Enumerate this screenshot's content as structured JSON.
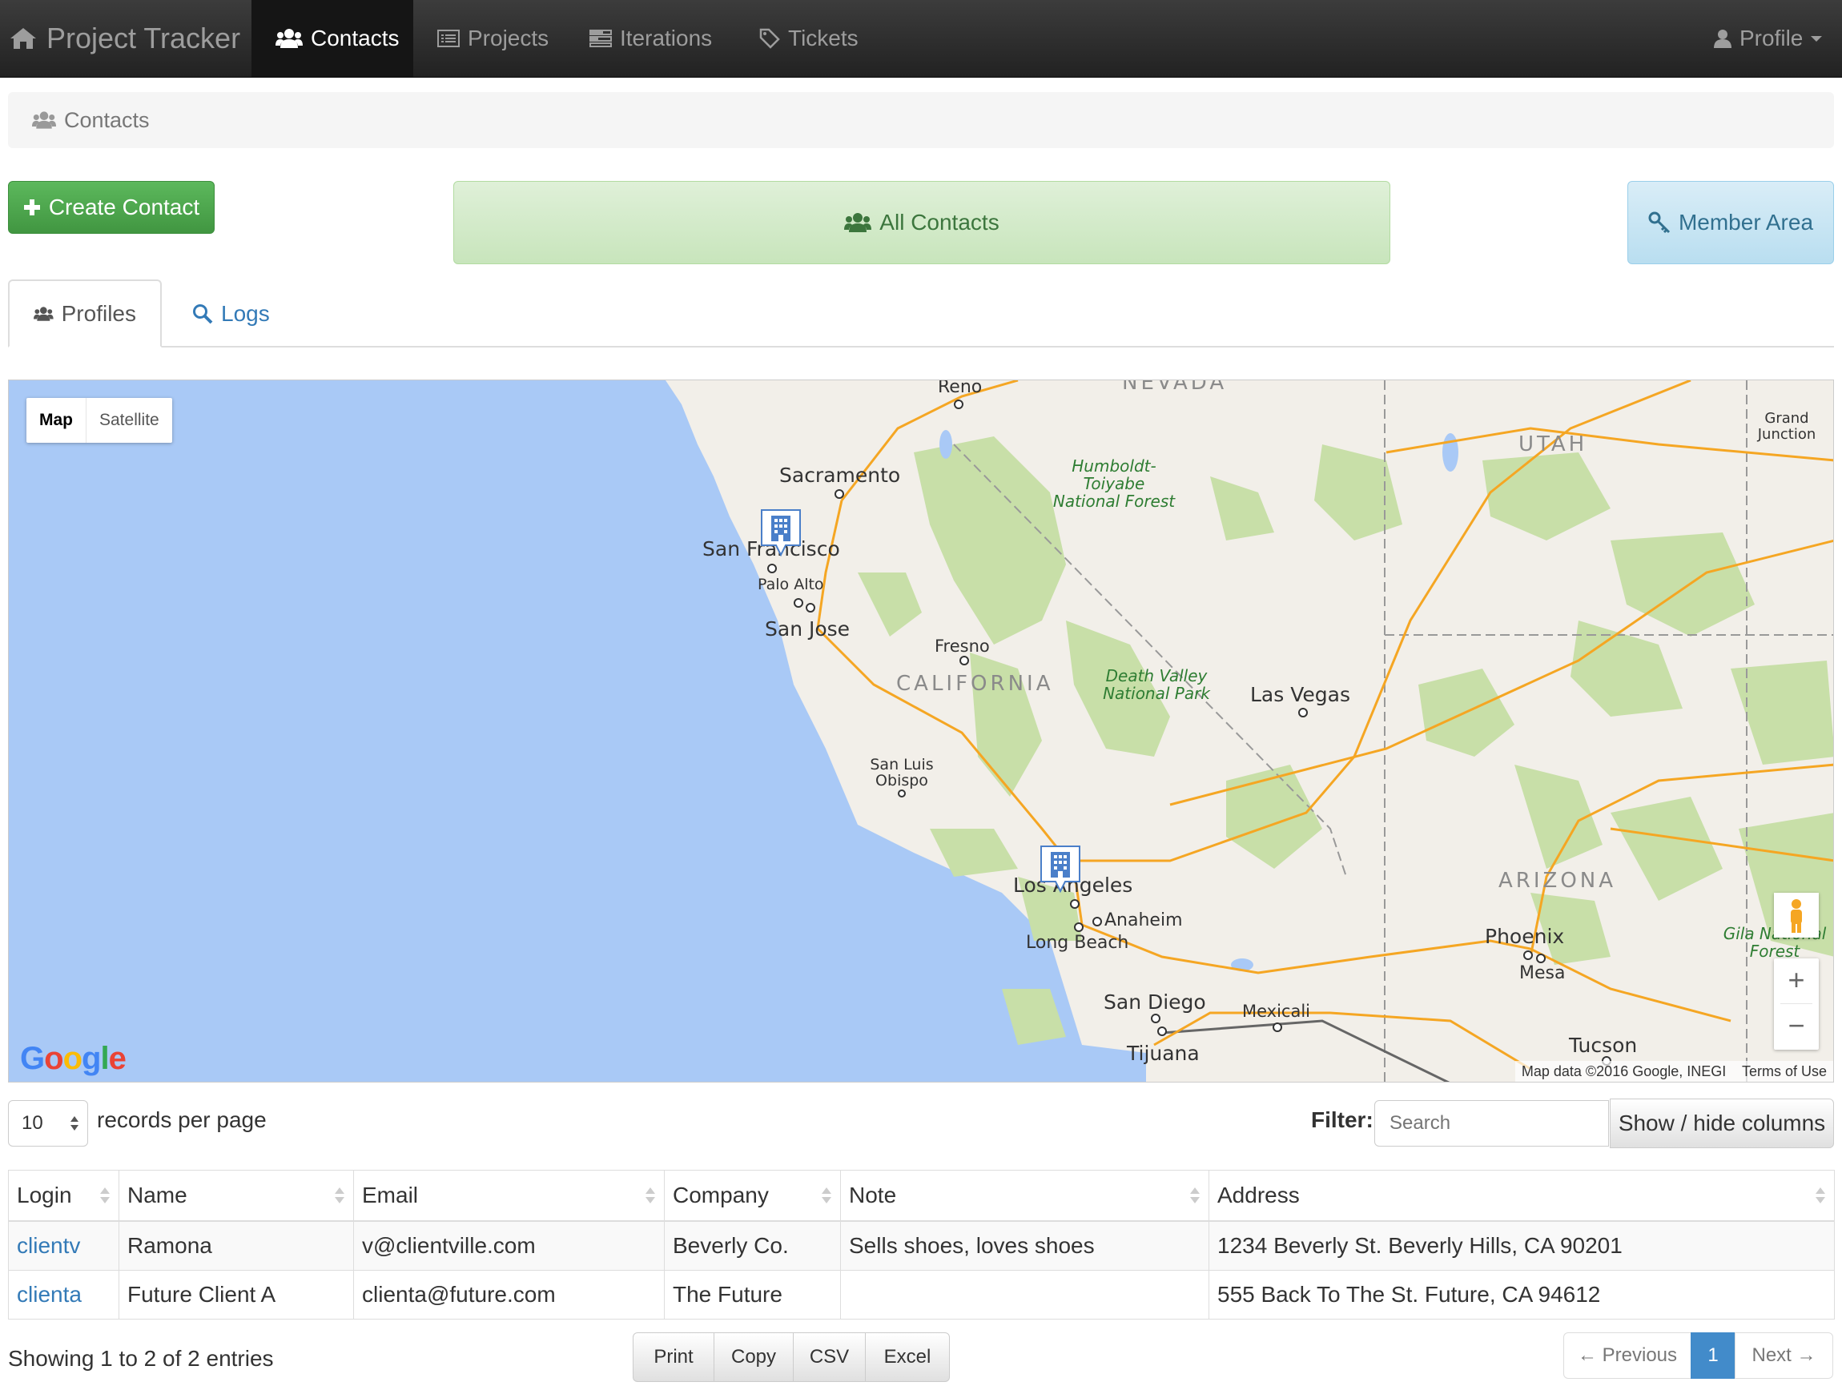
{
  "navbar": {
    "brand": "Project Tracker",
    "items": [
      {
        "label": "Contacts",
        "icon": "users-icon",
        "active": true
      },
      {
        "label": "Projects",
        "icon": "list-alt-icon",
        "active": false
      },
      {
        "label": "Iterations",
        "icon": "tasks-icon",
        "active": false
      },
      {
        "label": "Tickets",
        "icon": "tag-icon",
        "active": false
      }
    ],
    "profile": "Profile"
  },
  "breadcrumb": "Contacts",
  "actions": {
    "create": "Create Contact",
    "all": "All Contacts",
    "member": "Member Area"
  },
  "tabs": {
    "profiles": "Profiles",
    "logs": "Logs"
  },
  "map": {
    "type_map": "Map",
    "type_satellite": "Satellite",
    "google": "Google",
    "attribution": "Map data ©2016 Google, INEGI",
    "terms": "Terms of Use",
    "cities": {
      "reno": "Reno",
      "sacramento": "Sacramento",
      "sf": "San Francisco",
      "palo_alto": "Palo Alto",
      "san_jose": "San Jose",
      "fresno": "Fresno",
      "las_vegas": "Las Vegas",
      "slo": "San Luis Obispo",
      "la": "Los Angeles",
      "anaheim": "Anaheim",
      "long_beach": "Long Beach",
      "san_diego": "San Diego",
      "tijuana": "Tijuana",
      "mexicali": "Mexicali",
      "phoenix": "Phoenix",
      "mesa": "Mesa",
      "tucson": "Tucson",
      "grand_junction": "Grand Junction"
    },
    "states": {
      "nevada": "NEVADA",
      "utah": "UTAH",
      "california": "CALIFORNIA",
      "arizona": "ARIZONA"
    },
    "parks": {
      "humboldt": "Humboldt-Toiyabe National Forest",
      "death_valley": "Death Valley National Park",
      "gila": "Gila National Forest"
    }
  },
  "controls": {
    "page_size": "10",
    "records_label": "records per page",
    "filter_label": "Filter:",
    "filter_placeholder": "Search",
    "show_hide": "Show / hide columns"
  },
  "table": {
    "headers": [
      "Login",
      "Name",
      "Email",
      "Company",
      "Note",
      "Address"
    ],
    "rows": [
      [
        "clientv",
        "Ramona",
        "v@clientville.com",
        "Beverly Co.",
        "Sells shoes, loves shoes",
        "1234 Beverly St. Beverly Hills, CA 90201"
      ],
      [
        "clienta",
        "Future Client A",
        "clienta@future.com",
        "The Future",
        "",
        "555 Back To The St. Future, CA 94612"
      ]
    ]
  },
  "footer": {
    "info": "Showing 1 to 2 of 2 entries",
    "export": [
      "Print",
      "Copy",
      "CSV",
      "Excel"
    ],
    "pager": {
      "prev": "← Previous",
      "current": "1",
      "next": "Next →"
    }
  },
  "colors": {
    "navbar": "#222222",
    "link": "#337ab7",
    "success": "#5cb85c",
    "water": "#a9c9f6",
    "land": "#f2efe9",
    "park": "#c8dfa8",
    "road": "#f5a623"
  }
}
